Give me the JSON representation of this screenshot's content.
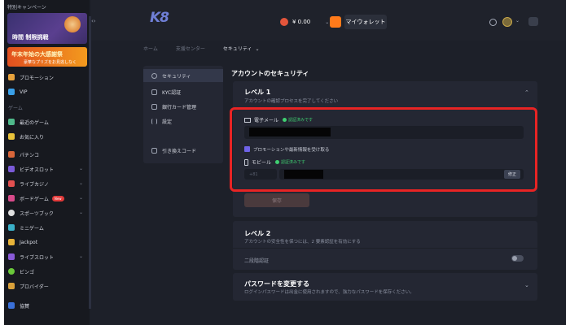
{
  "sidebar": {
    "promo_tag": "特別キャンペーン",
    "banner1_title": "時間 制限挑戦",
    "banner2_title": "年末年始の大感謝祭",
    "banner2_sub": "豪華なプリズをお見逃しなく",
    "section_game": "ゲーム",
    "items": [
      {
        "label": "プロモーション",
        "icon": "gift-icon",
        "color": "#e6a23c"
      },
      {
        "label": "VIP",
        "icon": "diamond-icon",
        "color": "#3aa0e8"
      },
      {
        "label": "最近のゲーム",
        "icon": "clock-icon",
        "color": "#4fb98a"
      },
      {
        "label": "お気に入り",
        "icon": "star-icon",
        "color": "#e8c23a"
      },
      {
        "label": "パチンコ",
        "icon": "pachinko-icon",
        "color": "#d9663a"
      },
      {
        "label": "ビデオスロット",
        "icon": "slot-icon",
        "color": "#7a5ad8"
      },
      {
        "label": "ライブカジノ",
        "icon": "cards-icon",
        "color": "#e25050"
      },
      {
        "label": "ボードゲーム",
        "icon": "board-icon",
        "color": "#d84a8a"
      },
      {
        "label": "スポーツブック",
        "icon": "soccer-icon",
        "color": "#e0e0e0"
      },
      {
        "label": "ミニゲーム",
        "icon": "mini-game-icon",
        "color": "#3ab0c8"
      },
      {
        "label": "Jackpot",
        "icon": "crown-icon",
        "color": "#e8b43a"
      },
      {
        "label": "ライブスロット",
        "icon": "live-slot-icon",
        "color": "#8a5ad8"
      },
      {
        "label": "ビンゴ",
        "icon": "bingo-icon",
        "color": "#6ac83a"
      },
      {
        "label": "プロバイダー",
        "icon": "provider-icon",
        "color": "#d8a03a"
      },
      {
        "label": "協賛",
        "icon": "sponsor-icon",
        "color": "#3a70d8"
      }
    ],
    "new_badge": "New"
  },
  "header": {
    "logo": "K8",
    "balance": "¥ 0.00",
    "wallet_label": "マイウォレット"
  },
  "breadcrumb": [
    "ホーム",
    "支援センター",
    "セキュリティ"
  ],
  "tabs": [
    {
      "label": "セキュリティ",
      "icon": "shield-icon"
    },
    {
      "label": "KYC認証",
      "icon": "id-card-icon"
    },
    {
      "label": "銀行カード管理",
      "icon": "bank-card-icon"
    },
    {
      "label": "設定",
      "icon": "sliders-icon"
    },
    {
      "label": "引き換えコード",
      "icon": "code-icon"
    }
  ],
  "main": {
    "title": "アカウントのセキュリティ",
    "level1": {
      "title": "レベル 1",
      "desc": "アカウントの確認プロセスを完了してください",
      "email_label": "電子メール",
      "verified_text": "認証済みです",
      "checkbox_label": "プロモーションや最新情報を受け取る",
      "mobile_label": "モビール",
      "phone_prefix": "+81",
      "edit_label": "修正",
      "save_label": "保存"
    },
    "level2": {
      "title": "レベル 2",
      "desc": "アカウントの安全性を保つには、2 要素認証を有効にする",
      "twofa_label": "二段階認証"
    },
    "password": {
      "title": "パスワードを変更する",
      "desc": "ログインパスワードは出金に使用されますので、強力なパスワードを保存ください。"
    }
  }
}
